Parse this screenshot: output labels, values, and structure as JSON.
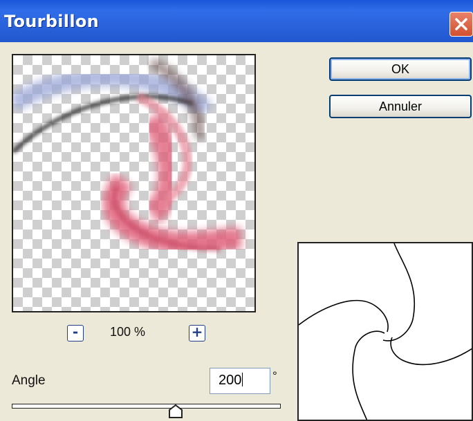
{
  "window": {
    "title": "Tourbillon"
  },
  "buttons": {
    "ok_label": "OK",
    "cancel_label": "Annuler"
  },
  "zoom": {
    "minus_label": "-",
    "plus_label": "+",
    "value": "100 %"
  },
  "angle": {
    "label": "Angle",
    "value": "200",
    "unit": "°"
  },
  "slider": {
    "position_fraction": 0.61
  },
  "colors": {
    "titlebar": "#2a63dc",
    "dialog_bg": "#ECE9D8",
    "close_button": "#d2502f",
    "swirl_pink": "#e0607a"
  },
  "icons": {
    "close": "close-icon"
  }
}
